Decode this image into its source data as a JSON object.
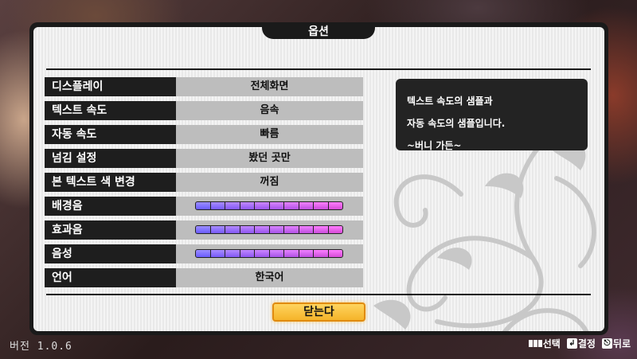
{
  "dialog": {
    "title": "옵션"
  },
  "settings": [
    {
      "label": "디스플레이",
      "value": "전체화면",
      "type": "option"
    },
    {
      "label": "텍스트 속도",
      "value": "음속",
      "type": "option"
    },
    {
      "label": "자동 속도",
      "value": "빠름",
      "type": "option"
    },
    {
      "label": "넘김 설정",
      "value": "봤던 곳만",
      "type": "option"
    },
    {
      "label": "본 텍스트 색 변경",
      "value": "꺼짐",
      "type": "option"
    },
    {
      "label": "배경음",
      "value": "",
      "type": "slider",
      "level": 10,
      "max": 10
    },
    {
      "label": "효과음",
      "value": "",
      "type": "slider",
      "level": 10,
      "max": 10
    },
    {
      "label": "음성",
      "value": "",
      "type": "slider",
      "level": 10,
      "max": 10
    },
    {
      "label": "언어",
      "value": "한국어",
      "type": "option"
    }
  ],
  "sample_text": {
    "line1": "텍스트 속도의 샘플과",
    "line2": "자동 속도의 샘플입니다.",
    "line3": "~버니 가든~"
  },
  "close_button": "닫는다",
  "version": "버전 1.0.6",
  "hints": {
    "select": "선택",
    "confirm": "결정",
    "back": "뒤로"
  },
  "colors": {
    "panel_dark": "#1a1a1a",
    "value_bg": "#bdbdbd",
    "slider_start": "#6a5cff",
    "slider_end": "#d64bd6",
    "button_accent": "#f5b42a"
  }
}
